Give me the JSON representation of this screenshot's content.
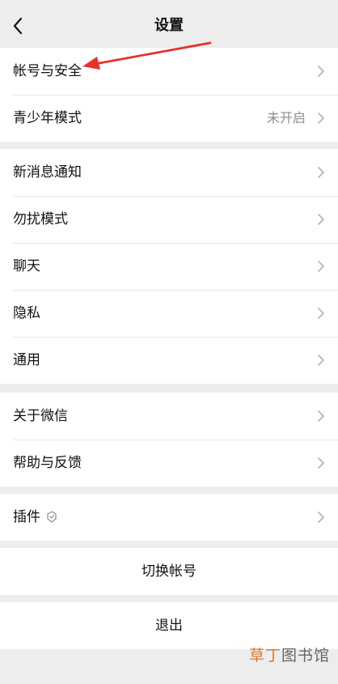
{
  "header": {
    "title": "设置",
    "back_icon": "chevron-left-icon"
  },
  "groups": [
    {
      "rows": [
        {
          "label": "帐号与安全"
        },
        {
          "label": "青少年模式",
          "value": "未开启"
        }
      ]
    },
    {
      "rows": [
        {
          "label": "新消息通知"
        },
        {
          "label": "勿扰模式"
        },
        {
          "label": "聊天"
        },
        {
          "label": "隐私"
        },
        {
          "label": "通用"
        }
      ]
    },
    {
      "rows": [
        {
          "label": "关于微信"
        },
        {
          "label": "帮助与反馈"
        }
      ]
    },
    {
      "rows": [
        {
          "label": "插件",
          "icon": "plugin-icon"
        }
      ]
    }
  ],
  "actions": {
    "switch_account": "切换帐号",
    "logout": "退出"
  },
  "annotation": {
    "arrow_color": "#e8312b"
  },
  "watermark": {
    "accent_part": "草丁",
    "rest_part": "图书馆"
  },
  "colors": {
    "background": "#ededed",
    "cell": "#ffffff",
    "secondary_text": "#8e8e8e",
    "chevron": "#b2b2b2"
  }
}
